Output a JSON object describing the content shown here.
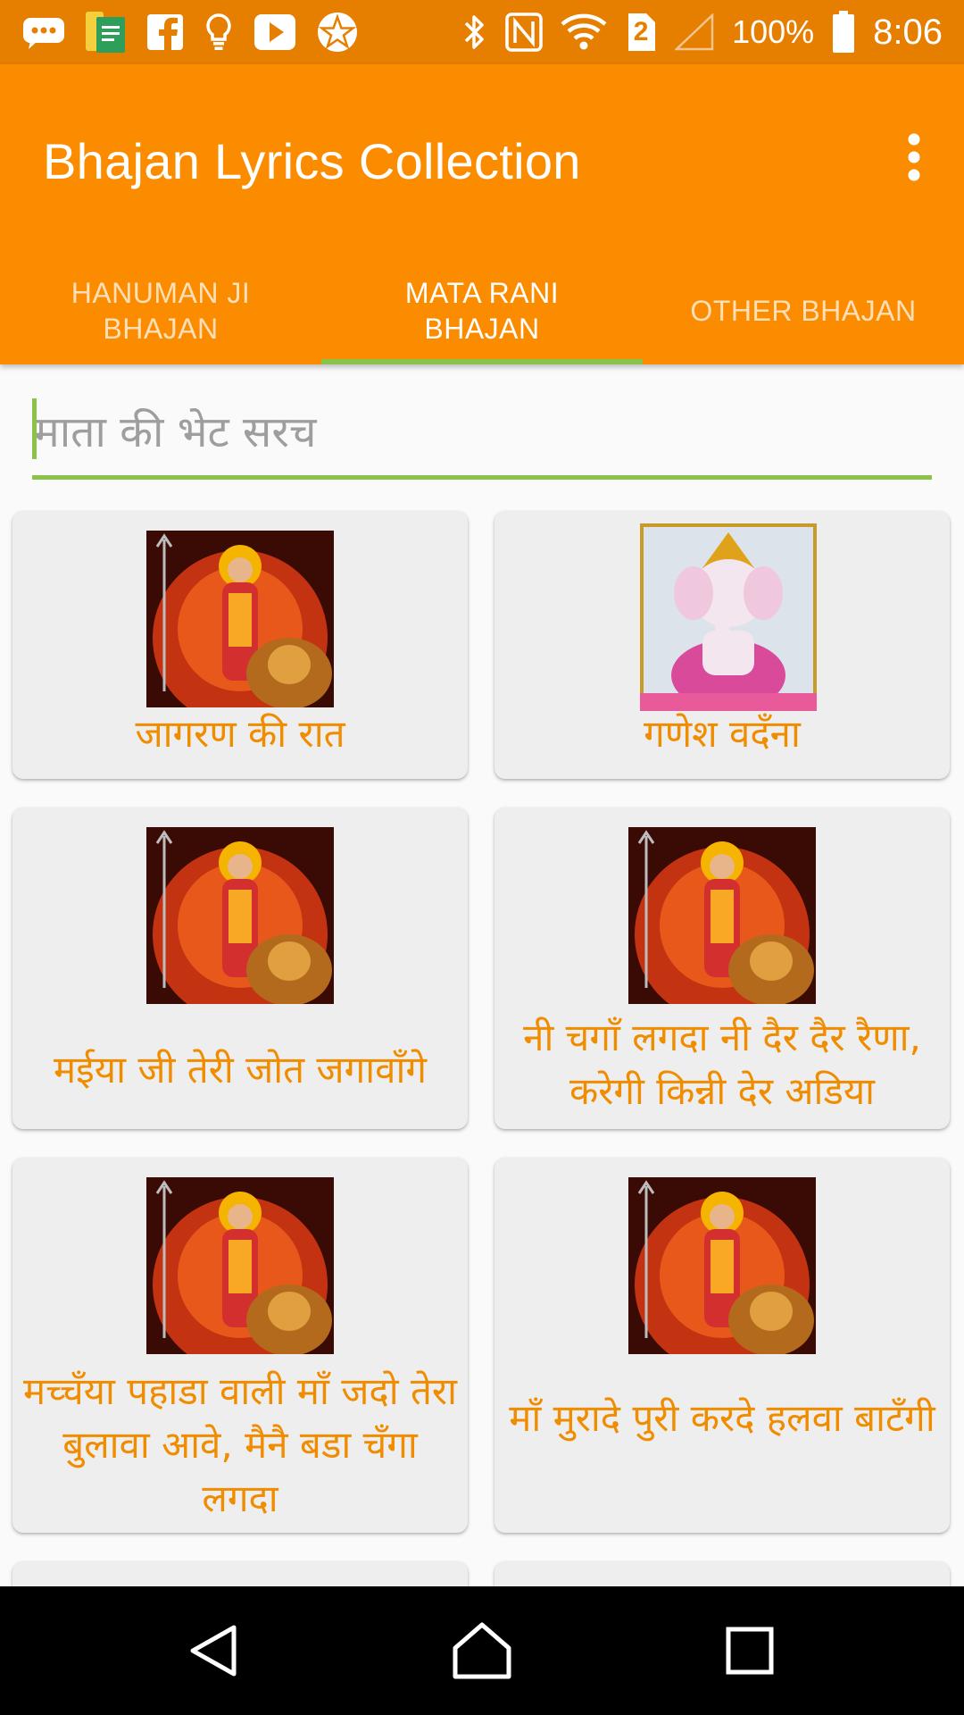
{
  "status_bar": {
    "battery": "100%",
    "time": "8:06",
    "notification_badge": "2",
    "icons_left": [
      "chat-bubble-icon",
      "notes-app-icon",
      "facebook-icon",
      "bulb-icon",
      "play-icon",
      "pentagram-icon"
    ],
    "icons_right": [
      "bluetooth-icon",
      "nfc-icon",
      "wifi-icon",
      "sim-badge-icon",
      "signal-icon",
      "battery-icon"
    ]
  },
  "app_bar": {
    "title": "Bhajan Lyrics Collection",
    "overflow_icon": "more-vert-icon"
  },
  "tabs": [
    {
      "line1": "HANUMAN JI",
      "line2": "BHAJAN",
      "active": false
    },
    {
      "line1": "MATA RANI",
      "line2": "BHAJAN",
      "active": true
    },
    {
      "line1": "OTHER BHAJAN",
      "line2": "",
      "active": false
    }
  ],
  "search": {
    "placeholder": "माता की भेट सरच",
    "value": ""
  },
  "cards": [
    {
      "title": "जागरण की रात",
      "image": "durga-mata-image"
    },
    {
      "title": "गणेश वदँना",
      "image": "ganesh-image"
    },
    {
      "title": "मईया जी तेरी जोत जगावाँगे",
      "image": "durga-mata-image"
    },
    {
      "title": "नी चगाँ लगदा नी दैर दैर रैणा, करेगी किन्नी देर अडिया",
      "image": "durga-mata-image"
    },
    {
      "title": "मच्चँया पहाडा वाली माँ जदो तेरा बुलावा आवे, मैनै बडा चँगा लगदा",
      "image": "durga-mata-image"
    },
    {
      "title": "माँ मुरादे पुरी करदे हलवा बाटँगी",
      "image": "durga-mata-image"
    }
  ],
  "colors": {
    "status_bar": "#e67e00",
    "primary": "#fb8c00",
    "accent": "#8bc34a",
    "card_text": "#f08c00",
    "card_bg": "#eeeeee"
  },
  "nav_bar": {
    "icons": [
      "back-icon",
      "home-icon",
      "recents-icon"
    ]
  }
}
